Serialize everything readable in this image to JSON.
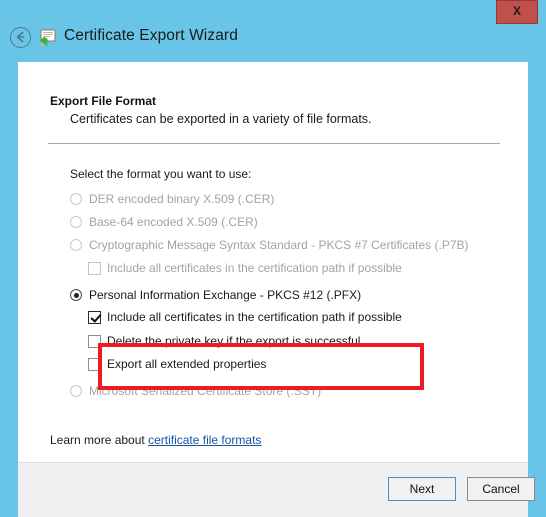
{
  "window": {
    "title": "Certificate Export Wizard",
    "close_label": "X",
    "back_icon": "back-arrow-icon",
    "wizard_icon": "certificate-icon",
    "titlebar_color": "#68c5e8"
  },
  "header": {
    "title": "Export File Format",
    "subtitle": "Certificates can be exported in a variety of file formats."
  },
  "body": {
    "prompt": "Select the format you want to use:",
    "options": [
      {
        "label": "DER encoded binary X.509 (.CER)",
        "type": "radio",
        "checked": false,
        "disabled": true,
        "indent": 0
      },
      {
        "label": "Base-64 encoded X.509 (.CER)",
        "type": "radio",
        "checked": false,
        "disabled": true,
        "indent": 0
      },
      {
        "label": "Cryptographic Message Syntax Standard - PKCS #7 Certificates (.P7B)",
        "type": "radio",
        "checked": false,
        "disabled": true,
        "indent": 0
      },
      {
        "label": "Include all certificates in the certification path if possible",
        "type": "checkbox",
        "checked": false,
        "disabled": true,
        "indent": 1
      },
      {
        "label": "Personal Information Exchange - PKCS #12 (.PFX)",
        "type": "radio",
        "checked": true,
        "disabled": false,
        "indent": 0
      },
      {
        "label": "Include all certificates in the certification path if possible",
        "type": "checkbox",
        "checked": true,
        "disabled": false,
        "indent": 1
      },
      {
        "label": "Delete the private key if the export is successful",
        "type": "checkbox",
        "checked": false,
        "disabled": false,
        "indent": 1
      },
      {
        "label": "Export all extended properties",
        "type": "checkbox",
        "checked": false,
        "disabled": false,
        "indent": 1
      },
      {
        "label": "Microsoft Serialized Certificate Store (.SST)",
        "type": "radio",
        "checked": false,
        "disabled": true,
        "indent": 0
      }
    ],
    "highlight_color": "#ed1c24",
    "learn_more_prefix": "Learn more about ",
    "learn_more_link": "certificate file formats"
  },
  "footer": {
    "next_label": "Next",
    "cancel_label": "Cancel"
  }
}
